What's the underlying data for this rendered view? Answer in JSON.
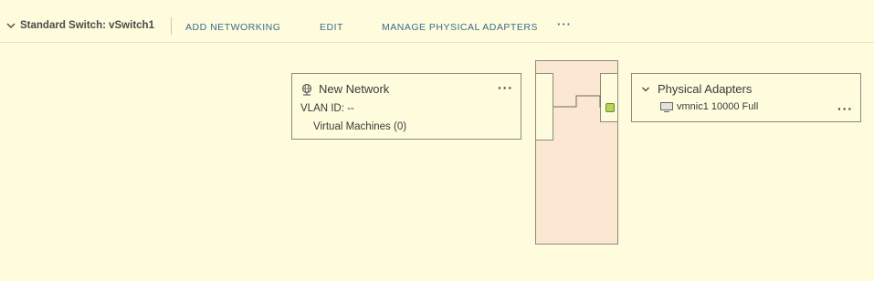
{
  "toolbar": {
    "title": "Standard Switch: vSwitch1",
    "add_networking": "ADD NETWORKING",
    "edit": "EDIT",
    "manage_adapters": "MANAGE PHYSICAL ADAPTERS",
    "more": "···"
  },
  "port_group": {
    "name": "New Network",
    "vlan": "VLAN ID: --",
    "vms": "Virtual Machines (0)",
    "more": "···",
    "icon": "network-globe-icon"
  },
  "physical_adapters": {
    "title": "Physical Adapters",
    "adapter": "vmnic1 10000 Full",
    "more": "···",
    "icon": "nic-icon"
  },
  "colors": {
    "background": "#fefcdc",
    "switch_fill": "#fce8d2",
    "link_blue": "#3d6a8f",
    "uplink_green": "#b6d35a"
  }
}
